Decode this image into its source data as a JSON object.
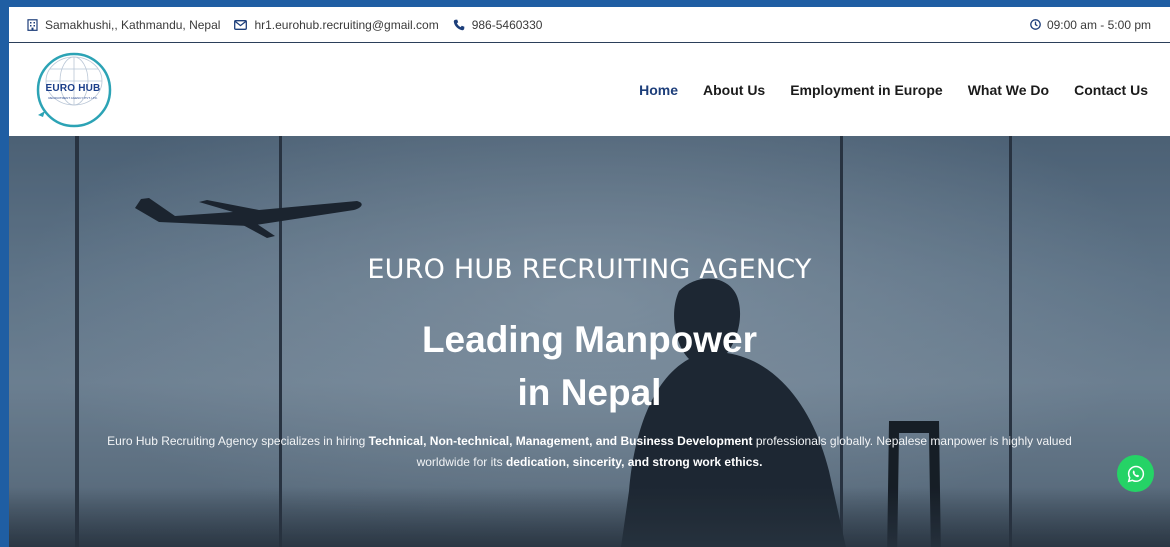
{
  "topbar": {
    "address": "Samakhushi,, Kathmandu, Nepal",
    "email": "hr1.eurohub.recruiting@gmail.com",
    "phone": "986-5460330",
    "hours": "09:00 am - 5:00 pm"
  },
  "logo": {
    "title": "EURO HUB",
    "subtitle": "RECRUITMENT AGENCY PVT. LTD."
  },
  "nav": {
    "items": [
      "Home",
      "About Us",
      "Employment in Europe",
      "What We Do",
      "Contact Us"
    ],
    "active": "Home"
  },
  "hero": {
    "kicker": "EURO HUB RECRUITING AGENCY",
    "title_line1": "Leading Manpower",
    "title_line2": "in Nepal",
    "desc_part1": "Euro Hub Recruiting Agency specializes in hiring ",
    "desc_bold1": "Technical, Non-technical, Management, and Business Development",
    "desc_part2": " professionals globally. Nepalese manpower is highly valued worldwide for its ",
    "desc_bold2": "dedication, sincerity, and strong work ethics.",
    "desc_part3": ""
  },
  "colors": {
    "accent": "#1d3e7a",
    "frame": "#1f5ea3",
    "whatsapp": "#25d366"
  },
  "icons": [
    "building-icon",
    "envelope-icon",
    "phone-icon",
    "clock-icon",
    "whatsapp-icon"
  ]
}
